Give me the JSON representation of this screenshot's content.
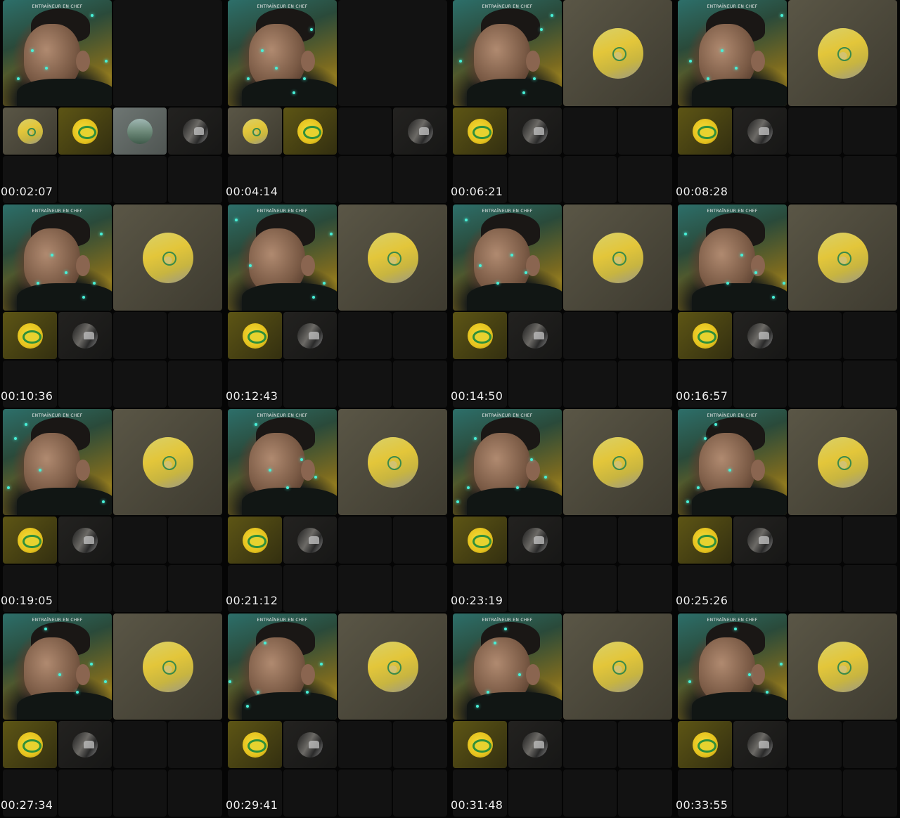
{
  "caption": "ENTRAÎNEUR EN CHEF",
  "frames": [
    {
      "timestamp": "00:02:07",
      "variant": "a"
    },
    {
      "timestamp": "00:04:14",
      "variant": "b"
    },
    {
      "timestamp": "00:06:21",
      "variant": "c"
    },
    {
      "timestamp": "00:08:28",
      "variant": "c"
    },
    {
      "timestamp": "00:10:36",
      "variant": "c"
    },
    {
      "timestamp": "00:12:43",
      "variant": "c"
    },
    {
      "timestamp": "00:14:50",
      "variant": "c"
    },
    {
      "timestamp": "00:16:57",
      "variant": "c"
    },
    {
      "timestamp": "00:19:05",
      "variant": "c"
    },
    {
      "timestamp": "00:21:12",
      "variant": "c"
    },
    {
      "timestamp": "00:23:19",
      "variant": "c"
    },
    {
      "timestamp": "00:25:26",
      "variant": "c"
    },
    {
      "timestamp": "00:27:34",
      "variant": "c"
    },
    {
      "timestamp": "00:29:41",
      "variant": "c"
    },
    {
      "timestamp": "00:31:48",
      "variant": "c"
    },
    {
      "timestamp": "00:33:55",
      "variant": "c"
    }
  ]
}
